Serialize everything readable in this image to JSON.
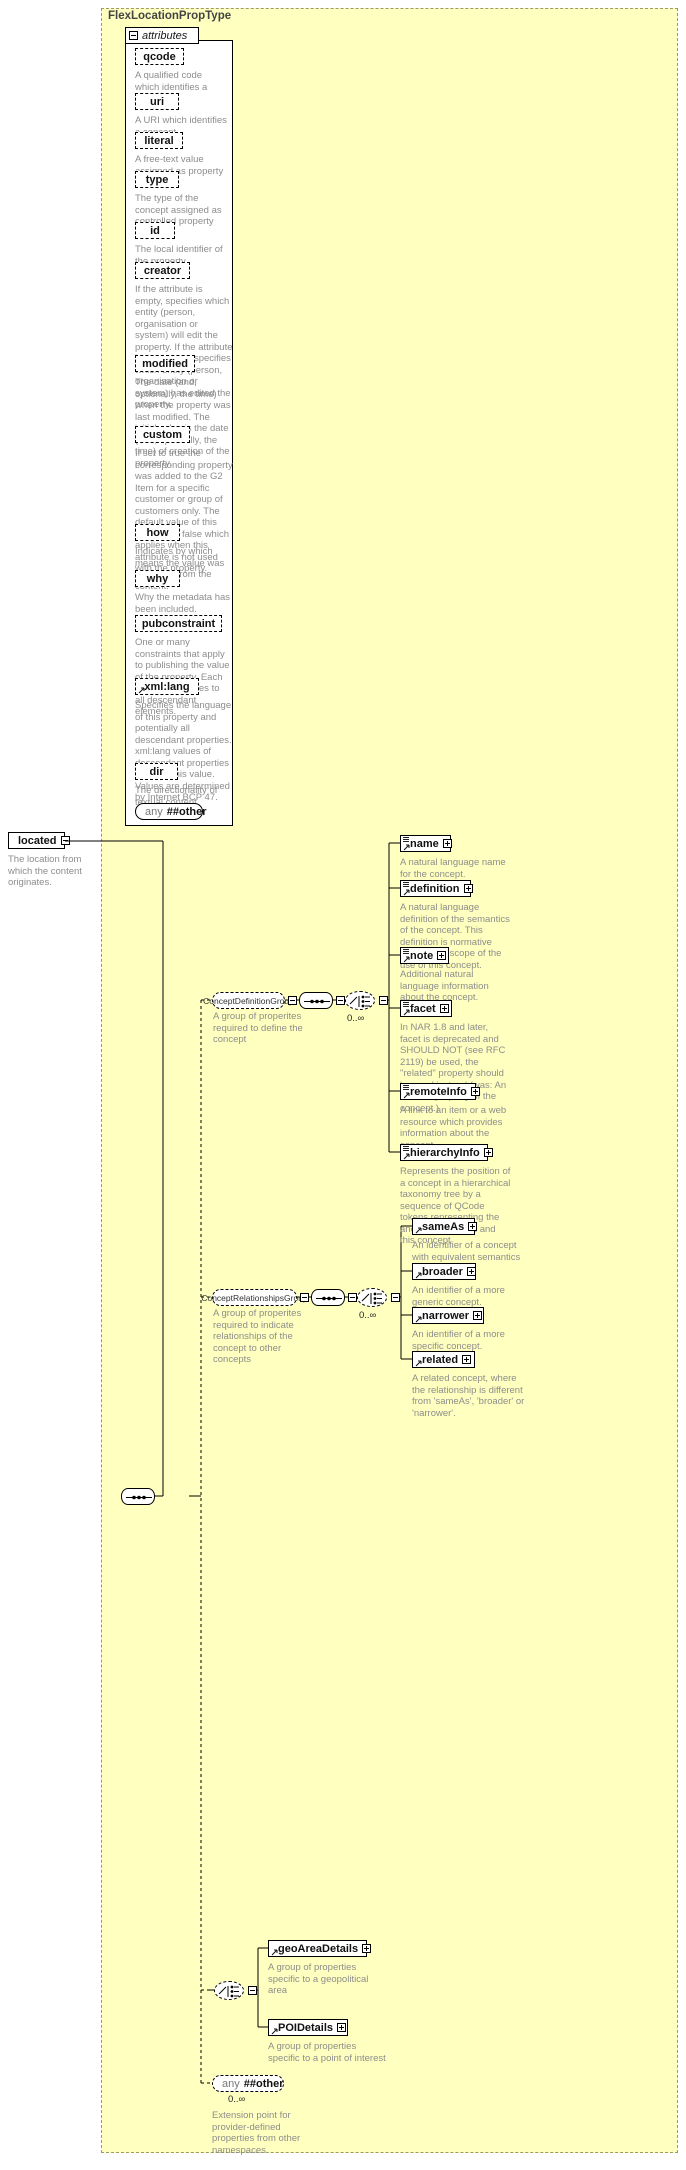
{
  "diagram": {
    "type_title": "FlexLocationPropType",
    "attributes_label": "attributes",
    "root_element": {
      "label": "located",
      "desc": "The location from which the content originates."
    },
    "colors": {
      "panel_background": "#ffffbf",
      "node_background": "#ffffff",
      "desc_text": "#8d8d8d",
      "border": "#000000"
    }
  },
  "attributes": [
    {
      "name": "qcode",
      "desc": "A qualified code which identifies a concept."
    },
    {
      "name": "uri",
      "desc": "A URI which identifies a concept."
    },
    {
      "name": "literal",
      "desc": "A free-text value assigned as property value."
    },
    {
      "name": "type",
      "desc": "The type of the concept assigned as controlled property value."
    },
    {
      "name": "id",
      "desc": "The local identifier of the property."
    },
    {
      "name": "creator",
      "desc": "If the attribute is empty, specifies which entity (person, organisation or system) will edit the property. If the attribute is non-empty, specifies which entity (person, organisation or system) has edited the property."
    },
    {
      "name": "modified",
      "desc": "The date (and, optionally, the time) when the property was last modified. The initial value is the date (and, optionally, the time) of creation of the property."
    },
    {
      "name": "custom",
      "desc": "If set to true the corresponding property was added to the G2 Item for a specific customer or group of customers only. The default value of this property is false which applies when this attribute is not used with the property."
    },
    {
      "name": "how",
      "desc": "Indicates by which means the value was extracted from the content."
    },
    {
      "name": "why",
      "desc": "Why the metadata has been included."
    },
    {
      "name": "pubconstraint",
      "desc": "One or many constraints that apply to publishing the value of the property. Each constraint applies to all descendant elements."
    },
    {
      "name": "xml:lang",
      "desc": "Specifies the language of this property and potentially all descendant properties. xml:lang values of descendant properties override this value. Values are determined by Internet BCP 47."
    },
    {
      "name": "dir",
      "desc": "The directionality of textual content."
    }
  ],
  "attributes_any": {
    "keyword": "any",
    "namespace": "##other"
  },
  "groups": [
    {
      "id": "concept-definition-group",
      "name": "ConceptDefinitionGroup",
      "desc": "A group of properites required to define the concept",
      "cardinality": "0..∞",
      "children": [
        {
          "name": "name",
          "desc": "A natural language name for the concept."
        },
        {
          "name": "definition",
          "desc": "A natural language definition of the semantics of the concept. This definition is normative only for the scope of the use of this concept."
        },
        {
          "name": "note",
          "desc": "Additional natural language information about the concept."
        },
        {
          "name": "facet",
          "desc": "In NAR 1.8 and later, facet is deprecated and SHOULD NOT (see RFC 2119) be used, the \"related\" property should be used instead (was: An intrinsic property of the concept.)"
        },
        {
          "name": "remoteInfo",
          "desc": "A link to an item or a web resource which provides information about the concept"
        },
        {
          "name": "hierarchyInfo",
          "desc": "Represents the position of a concept in a hierarchical taxonomy tree by a sequence of QCode tokens representing the ancestor concepts and this concept"
        }
      ]
    },
    {
      "id": "concept-relationships-group",
      "name": "ConceptRelationshipsGroup",
      "desc": "A group of properites required to indicate relationships of the concept to other concepts",
      "cardinality": "0..∞",
      "children": [
        {
          "name": "sameAs",
          "desc": "An identifier of a concept with equivalent semantics"
        },
        {
          "name": "broader",
          "desc": "An identifier of a more generic concept."
        },
        {
          "name": "narrower",
          "desc": "An identifier of a more specific concept."
        },
        {
          "name": "related",
          "desc": "A related concept, where the relationship is different from 'sameAs', 'broader' or 'narrower'."
        }
      ]
    }
  ],
  "details_choice": {
    "children": [
      {
        "name": "geoAreaDetails",
        "desc": "A group of properties specific to a geopolitical area"
      },
      {
        "name": "POIDetails",
        "desc": "A group of properties specific to a point of interest"
      }
    ]
  },
  "body_any": {
    "keyword": "any",
    "namespace": "##other",
    "cardinality": "0..∞",
    "desc": "Extension point for provider-defined properties from other namespaces"
  }
}
